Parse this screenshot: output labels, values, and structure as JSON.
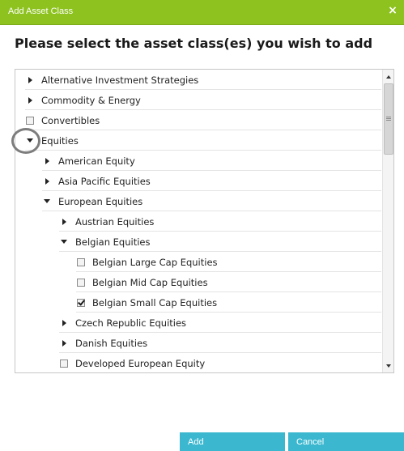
{
  "dialog": {
    "title": "Add Asset Class",
    "close_label": "×"
  },
  "heading": "Please select the asset class(es) you wish to add",
  "tree": {
    "items": [
      {
        "label": "Alternative Investment Strategies",
        "level": 0,
        "control": "expand",
        "state": "collapsed"
      },
      {
        "label": "Commodity & Energy",
        "level": 0,
        "control": "expand",
        "state": "collapsed"
      },
      {
        "label": "Convertibles",
        "level": 0,
        "control": "checkbox",
        "state": "unchecked"
      },
      {
        "label": "Equities",
        "level": 0,
        "control": "expand",
        "state": "expanded"
      },
      {
        "label": "American Equity",
        "level": 1,
        "control": "expand",
        "state": "collapsed"
      },
      {
        "label": "Asia Pacific Equities",
        "level": 1,
        "control": "expand",
        "state": "collapsed"
      },
      {
        "label": "European Equities",
        "level": 1,
        "control": "expand",
        "state": "expanded"
      },
      {
        "label": "Austrian Equities",
        "level": 2,
        "control": "expand",
        "state": "collapsed"
      },
      {
        "label": "Belgian Equities",
        "level": 2,
        "control": "expand",
        "state": "expanded"
      },
      {
        "label": "Belgian Large Cap Equities",
        "level": 3,
        "control": "checkbox",
        "state": "unchecked"
      },
      {
        "label": "Belgian Mid Cap Equities",
        "level": 3,
        "control": "checkbox",
        "state": "unchecked"
      },
      {
        "label": "Belgian Small Cap Equities",
        "level": 3,
        "control": "checkbox",
        "state": "checked"
      },
      {
        "label": "Czech Republic Equities",
        "level": 2,
        "control": "expand",
        "state": "collapsed"
      },
      {
        "label": "Danish Equities",
        "level": 2,
        "control": "expand",
        "state": "collapsed"
      },
      {
        "label": "Developed European Equity",
        "level": 2,
        "control": "checkbox",
        "state": "unchecked"
      }
    ]
  },
  "buttons": {
    "add": "Add",
    "cancel": "Cancel"
  },
  "colors": {
    "titlebar": "#8dc21f",
    "button": "#3bb8d0"
  }
}
